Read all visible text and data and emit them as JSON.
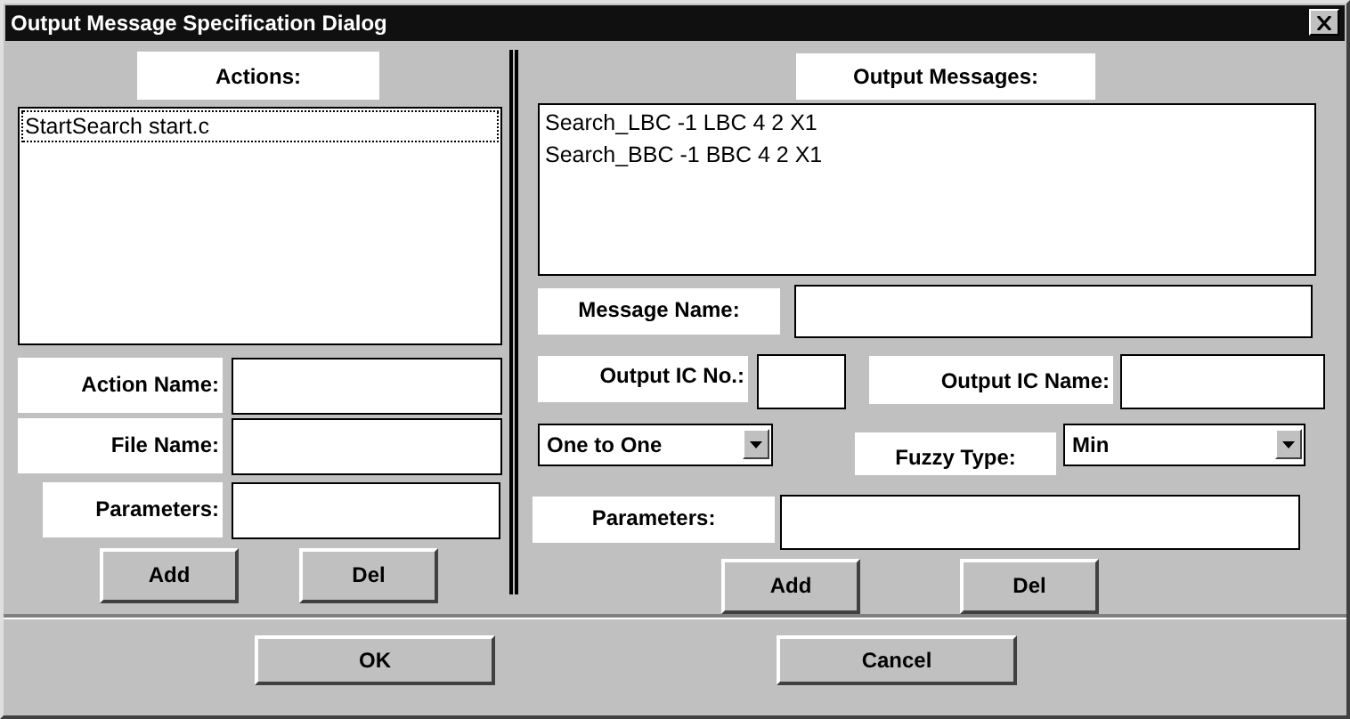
{
  "window": {
    "title": "Output Message Specification Dialog"
  },
  "actions": {
    "label": "Actions:",
    "items": [
      {
        "text": "StartSearch start.c",
        "selected": true
      }
    ],
    "fields": [
      {
        "label": "Action Name:"
      },
      {
        "label": "File Name:"
      },
      {
        "label": "Parameters:"
      }
    ],
    "buttons": [
      "Add",
      "Del"
    ]
  },
  "output_messages": {
    "label": "Output Messages:",
    "items": [
      {
        "text": "Search_LBC -1 LBC 4 2 X1",
        "selected": false
      },
      {
        "text": "Search_BBC -1 BBC 4 2 X1",
        "selected": false
      }
    ],
    "message_name": {
      "label": "Message Name:"
    },
    "output_ic_no": {
      "label": "Output IC No.:"
    },
    "output_ic_name": {
      "label": "Output IC Name:"
    },
    "mapping": {
      "value": "One to One"
    },
    "fuzzy_type": {
      "label": "Fuzzy Type:",
      "value": "Min"
    },
    "parameters": {
      "label": "Parameters:"
    },
    "buttons": [
      "Add",
      "Del"
    ]
  },
  "buttons": [
    "OK",
    "Cancel"
  ]
}
